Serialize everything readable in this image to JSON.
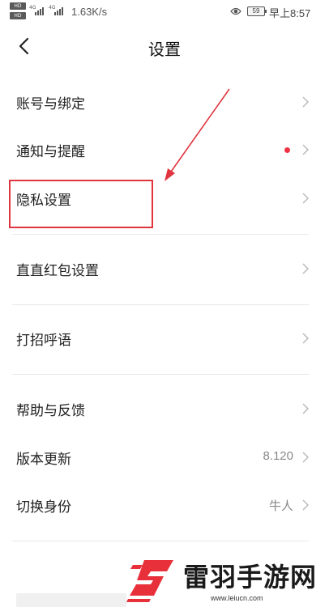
{
  "status_bar": {
    "hd_tags": [
      "HD",
      "HD"
    ],
    "signal_1_gen": "4G",
    "signal_2_gen": "4G",
    "network_speed": "1.63K/s",
    "battery_level": "59",
    "time": "早上8:57"
  },
  "nav": {
    "title": "设置"
  },
  "settings": {
    "items": [
      {
        "label": "账号与绑定",
        "value": ""
      },
      {
        "label": "通知与提醒",
        "value": "",
        "notification_dot": true
      },
      {
        "label": "隐私设置",
        "value": ""
      },
      {
        "label": "直直红包设置",
        "value": ""
      },
      {
        "label": "打招呼语",
        "value": ""
      },
      {
        "label": "帮助与反馈",
        "value": ""
      },
      {
        "label": "版本更新",
        "value": "8.120"
      },
      {
        "label": "切换身份",
        "value": "牛人"
      }
    ]
  },
  "annotation": {
    "highlight_color": "#e0353f",
    "highlighted_item": "隐私设置"
  },
  "watermark": {
    "name": "雷羽手游网",
    "url": "www.leiucn.com",
    "logo_color": "#e8303a"
  }
}
